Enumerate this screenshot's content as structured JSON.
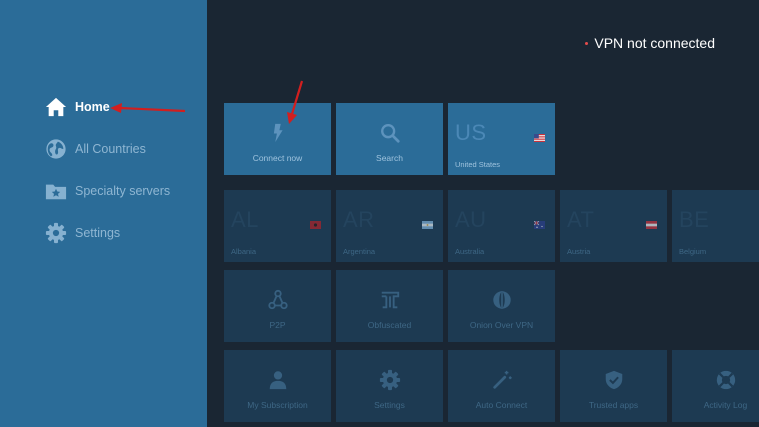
{
  "colors": {
    "sidebar": "#2b6c98",
    "main_background": "#1a2633",
    "tile": "#2b6c98",
    "tile_dim": "#1d3a52",
    "status_dot": "#e44c4c",
    "annotation_arrow": "#d11f1f"
  },
  "status": {
    "text": "VPN not connected"
  },
  "sidebar": {
    "items": [
      {
        "label": "Home",
        "icon": "home-icon",
        "active": true
      },
      {
        "label": "All Countries",
        "icon": "globe-icon",
        "active": false
      },
      {
        "label": "Specialty servers",
        "icon": "folder-star-icon",
        "active": false
      },
      {
        "label": "Settings",
        "icon": "gear-icon",
        "active": false
      }
    ]
  },
  "quick_actions": [
    {
      "label": "Connect now",
      "icon": "lightning-icon"
    },
    {
      "label": "Search",
      "icon": "search-icon"
    }
  ],
  "recent_country": {
    "code": "US",
    "name": "United States",
    "flag": "us-flag-icon"
  },
  "countries": [
    {
      "code": "AL",
      "name": "Albania",
      "flag": "albania-flag-icon"
    },
    {
      "code": "AR",
      "name": "Argentina",
      "flag": "argentina-flag-icon"
    },
    {
      "code": "AU",
      "name": "Australia",
      "flag": "australia-flag-icon"
    },
    {
      "code": "AT",
      "name": "Austria",
      "flag": "austria-flag-icon"
    },
    {
      "code": "BE",
      "name": "Belgium",
      "flag": ""
    }
  ],
  "specialty": [
    {
      "label": "P2P",
      "icon": "p2p-icon"
    },
    {
      "label": "Obfuscated",
      "icon": "obfuscated-icon"
    },
    {
      "label": "Onion Over VPN",
      "icon": "onion-icon"
    }
  ],
  "settings_row": [
    {
      "label": "My Subscription",
      "icon": "user-icon"
    },
    {
      "label": "Settings",
      "icon": "gear-icon"
    },
    {
      "label": "Auto Connect",
      "icon": "magic-wand-icon"
    },
    {
      "label": "Trusted apps",
      "icon": "shield-check-icon"
    },
    {
      "label": "Activity Log",
      "icon": "lifebuoy-icon"
    }
  ]
}
